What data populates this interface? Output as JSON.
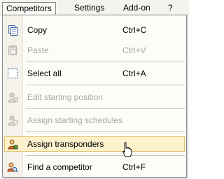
{
  "menubar": {
    "items": [
      {
        "label": "Competitors",
        "open": true
      },
      {
        "label": "Settings"
      },
      {
        "label": "Add-on"
      },
      {
        "label": "?"
      }
    ]
  },
  "menu": {
    "items": [
      {
        "label": "Copy",
        "shortcut": "Ctrl+C",
        "icon": "copy-icon",
        "enabled": true
      },
      {
        "label": "Paste",
        "shortcut": "Ctrl+V",
        "icon": "paste-icon",
        "enabled": false
      },
      {
        "label": "Select all",
        "shortcut": "Ctrl+A",
        "icon": "select-all-icon",
        "enabled": true
      },
      {
        "label": "Edit starting position",
        "shortcut": "",
        "icon": "edit-starting-position-icon",
        "enabled": false
      },
      {
        "label": "Assign starting schedules",
        "shortcut": "",
        "icon": "assign-starting-schedules-icon",
        "enabled": false
      },
      {
        "label": "Assign transponders",
        "shortcut": "",
        "icon": "assign-transponders-icon",
        "enabled": true,
        "highlighted": true
      },
      {
        "label": "Find a competitor",
        "shortcut": "Ctrl+F",
        "icon": "find-competitor-icon",
        "enabled": true
      }
    ]
  },
  "colors": {
    "menubar_bg": "#f4f3ee",
    "menu_bg": "#fcfcf9",
    "highlight_bg": "#fdf2cb",
    "highlight_border": "#e4c36e",
    "disabled_text": "#a9a9a2"
  }
}
